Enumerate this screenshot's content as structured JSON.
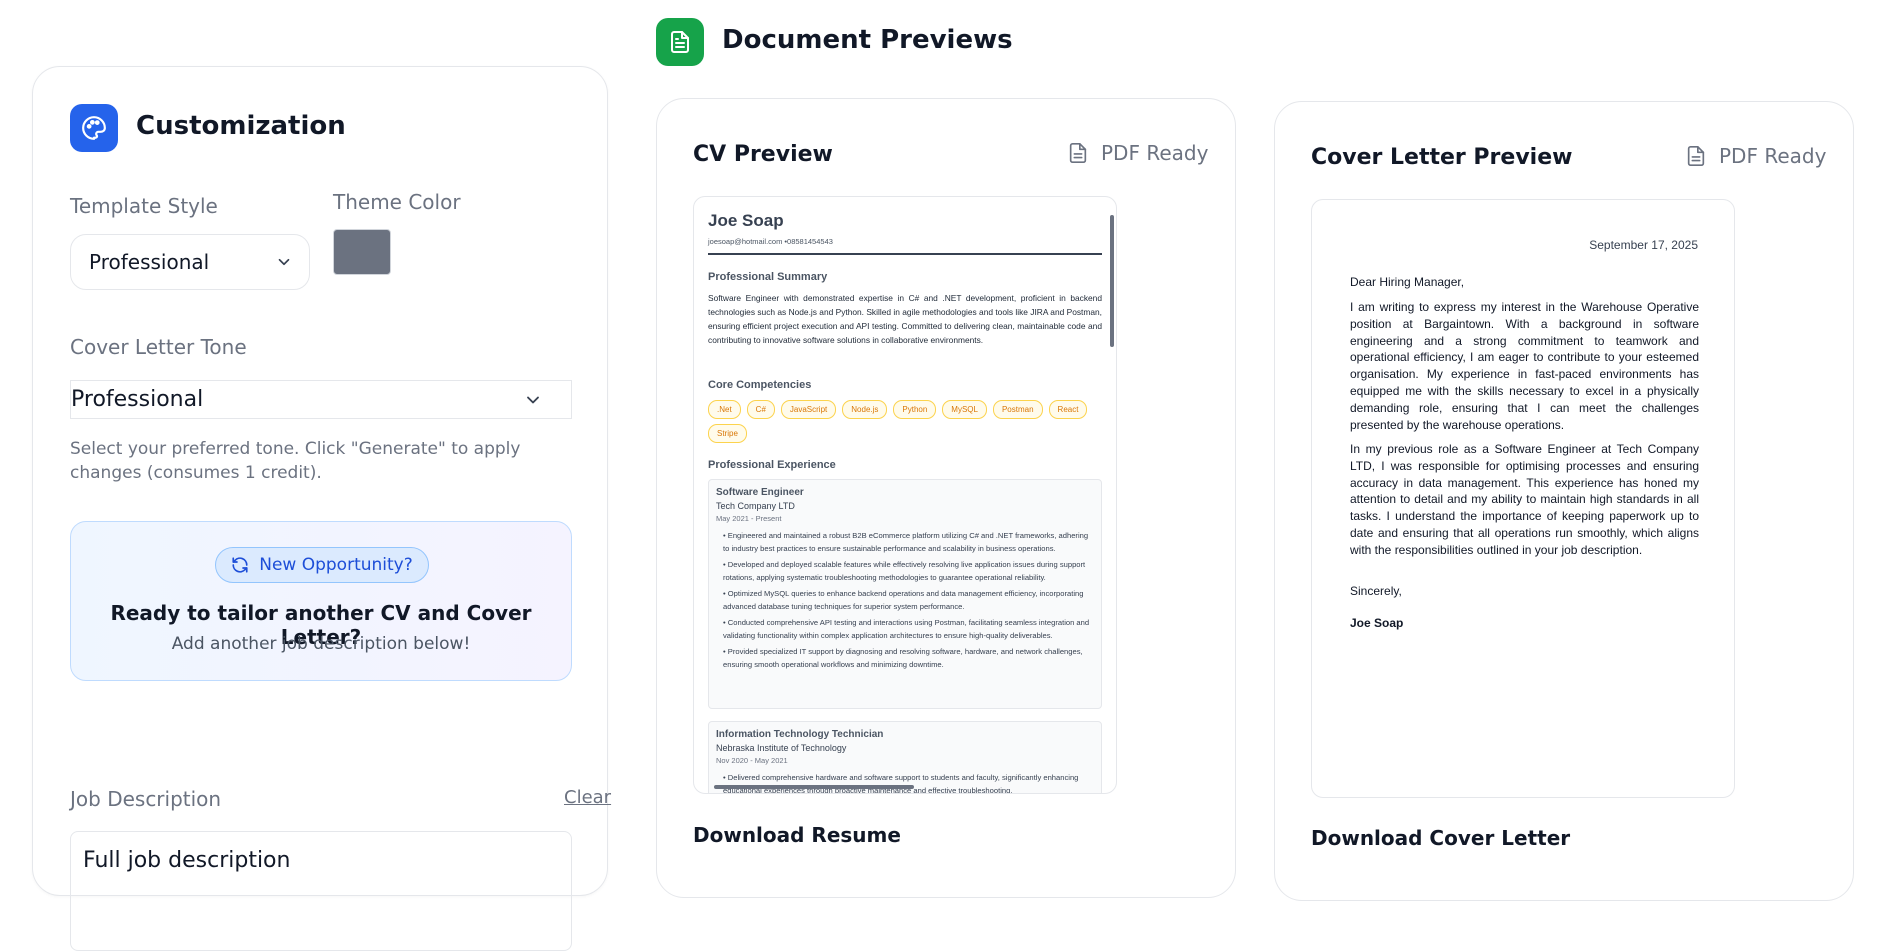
{
  "customization": {
    "title": "Customization",
    "template_style_label": "Template Style",
    "template_style_value": "Professional",
    "theme_color_label": "Theme Color",
    "theme_color_value": "#6b7280",
    "tone_label": "Cover Letter Tone",
    "tone_value": "Professional",
    "tone_help": "Select your preferred tone. Click \"Generate\" to apply changes (consumes 1 credit).",
    "opportunity": {
      "pill": "New Opportunity?",
      "title": "Ready to tailor another CV and Cover Letter?",
      "subtitle": "Add another job description below!"
    },
    "job_description_label": "Job Description",
    "clear_label": "Clear",
    "job_description_placeholder": "Full job description"
  },
  "previews": {
    "title": "Document Previews",
    "cv_title": "CV Preview",
    "cv_status": "PDF Ready",
    "cv_download": "Download Resume",
    "cl_title": "Cover Letter Preview",
    "cl_status": "PDF Ready",
    "cl_download": "Download Cover Letter"
  },
  "cv": {
    "name": "Joe Soap",
    "contact": "joesoap@hotmail.com •08581454543",
    "summary_heading": "Professional Summary",
    "summary": "Software Engineer with demonstrated expertise in C# and .NET development, proficient in backend technologies such as Node.js and Python. Skilled in agile methodologies and tools like JIRA and Postman, ensuring efficient project execution and API testing. Committed to delivering clean, maintainable code and contributing to innovative software solutions in collaborative environments.",
    "competencies_heading": "Core Competencies",
    "skills": [
      ".Net",
      "C#",
      "JavaScript",
      "Node.js",
      "Python",
      "MySQL",
      "Postman",
      "React",
      "Stripe"
    ],
    "experience_heading": "Professional Experience",
    "jobs": [
      {
        "title": "Software Engineer",
        "company": "Tech Company LTD",
        "dates": "May 2021 - Present",
        "bullets": [
          "• Engineered and maintained a robust B2B eCommerce platform utilizing C# and .NET frameworks, adhering to industry best practices to ensure sustainable performance and scalability in business operations.",
          "• Developed and deployed scalable features while effectively resolving live application issues during support rotations, applying systematic troubleshooting methodologies to guarantee operational reliability.",
          "• Optimized MySQL queries to enhance backend operations and data management efficiency, incorporating advanced database tuning techniques for superior system performance.",
          "• Conducted comprehensive API testing and interactions using Postman, facilitating seamless integration and validating functionality within complex application architectures to ensure high-quality deliverables.",
          "• Provided specialized IT support by diagnosing and resolving software, hardware, and network challenges, ensuring smooth operational workflows and minimizing downtime."
        ]
      },
      {
        "title": "Information Technology Technician",
        "company": "Nebraska Institute of Technology",
        "dates": "Nov 2020 - May 2021",
        "bullets": [
          "• Delivered comprehensive hardware and software support to students and faculty, significantly enhancing educational experiences through proactive maintenance and effective troubleshooting."
        ]
      }
    ]
  },
  "cover_letter": {
    "date": "September 17, 2025",
    "greeting": "Dear Hiring Manager,",
    "paragraph_1": "I am writing to express my interest in the Warehouse Operative position at Bargaintown. With a background in software engineering and a strong commitment to teamwork and operational efficiency, I am eager to contribute to your esteemed organisation. My experience in fast-paced environments has equipped me with the skills necessary to excel in a physically demanding role, ensuring that I can meet the challenges presented by the warehouse operations.",
    "paragraph_2": "In my previous role as a Software Engineer at Tech Company LTD, I was responsible for optimising processes and ensuring accuracy in data management. This experience has honed my attention to detail and my ability to maintain high standards in all tasks. I understand the importance of keeping paperwork up to date and ensuring that all operations run smoothly, which aligns with the responsibilities outlined in your job description.",
    "closing": "Sincerely,",
    "signature": "Joe Soap"
  },
  "colors": {
    "primary_blue": "#2563eb",
    "success_green": "#16a34a",
    "skill_chip": "#d97706"
  },
  "icons": [
    "palette-icon",
    "chevron-down-icon",
    "refresh-icon",
    "document-icon",
    "file-icon"
  ]
}
